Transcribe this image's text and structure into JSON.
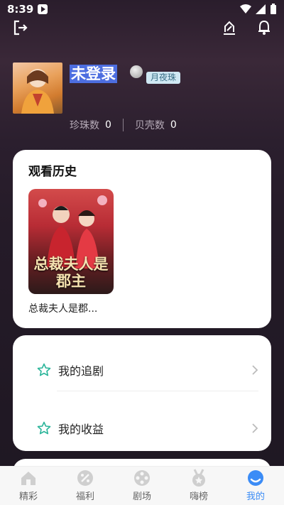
{
  "status_bar": {
    "time": "8:39"
  },
  "profile": {
    "username": "未登录",
    "badge_label": "月夜珠",
    "stats": [
      {
        "label": "珍珠数",
        "value": "0"
      },
      {
        "label": "贝壳数",
        "value": "0"
      }
    ]
  },
  "history": {
    "title": "观看历史",
    "items": [
      {
        "poster_text": "总裁夫人是郡主",
        "caption": "总裁夫人是郡..."
      }
    ]
  },
  "menu": {
    "items": [
      {
        "label": "我的追剧",
        "icon": "star-outline-icon"
      },
      {
        "label": "我的收益",
        "icon": "star-outline-icon"
      }
    ]
  },
  "tabbar": {
    "active": 4,
    "tabs": [
      {
        "label": "精彩",
        "icon": "home-icon"
      },
      {
        "label": "福利",
        "icon": "welfare-icon"
      },
      {
        "label": "剧场",
        "icon": "film-reel-icon"
      },
      {
        "label": "嗨榜",
        "icon": "medal-icon"
      },
      {
        "label": "我的",
        "icon": "profile-icon"
      }
    ]
  },
  "colors": {
    "accent": "#3b8cf6",
    "star": "#2bb59a",
    "name_highlight": "#4d6ee0"
  }
}
